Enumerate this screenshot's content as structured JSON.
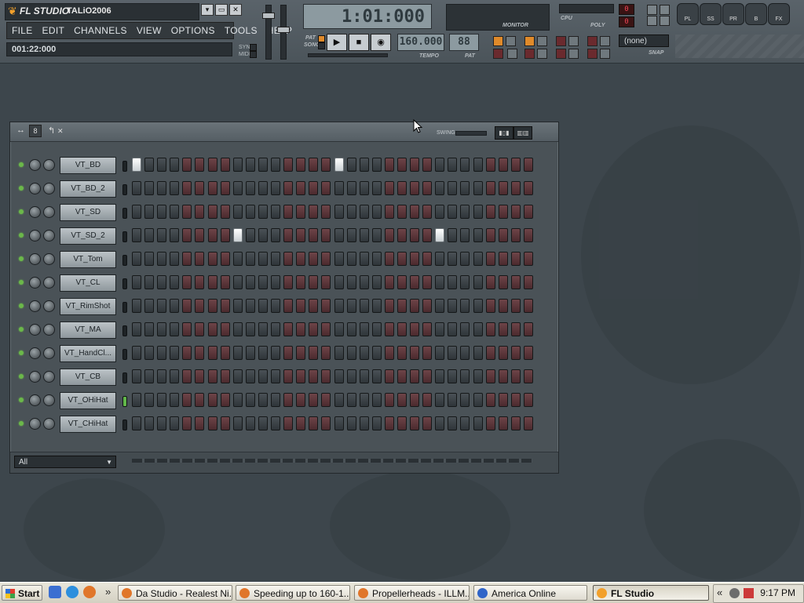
{
  "app": {
    "brand": "FL STUDIO",
    "project_name": "TALiO2006",
    "window_buttons": [
      "▾",
      "▭",
      "✕"
    ]
  },
  "menu": [
    "FILE",
    "EDIT",
    "CHANNELS",
    "VIEW",
    "OPTIONS",
    "TOOLS",
    "HELP"
  ],
  "position_readout": "001:22:000",
  "sync_labels": [
    "SYN",
    "MIDI"
  ],
  "song_position": "1:01:000",
  "transport": {
    "mode_labels": [
      "PAT",
      "SONG"
    ],
    "play_icon": "play-icon",
    "stop_icon": "stop-icon",
    "record_icon": "record-icon",
    "tempo_value": "160.000",
    "tempo_label": "TEMPO",
    "pattern_value": "88",
    "pattern_label": "PAT"
  },
  "meters": {
    "monitor_label": "MONITOR",
    "cpu_label": "CPU",
    "cpu_value": "0",
    "poly_label": "POLY",
    "poly_value": "0"
  },
  "snap": {
    "value": "(none)",
    "label": "SNAP"
  },
  "windows": {
    "playlist": "PL",
    "step_sequencer": "SS",
    "piano_roll": "PR",
    "browser": "B",
    "mixer": "FX"
  },
  "rack": {
    "swing_label": "SWING",
    "filter_value": "All",
    "channels": [
      {
        "name": "VT_BD",
        "active_steps": [
          1,
          17
        ],
        "selected": false
      },
      {
        "name": "VT_BD_2",
        "active_steps": [],
        "selected": false
      },
      {
        "name": "VT_SD",
        "active_steps": [],
        "selected": false
      },
      {
        "name": "VT_SD_2",
        "active_steps": [
          9,
          25
        ],
        "selected": false
      },
      {
        "name": "VT_Tom",
        "active_steps": [],
        "selected": false
      },
      {
        "name": "VT_CL",
        "active_steps": [],
        "selected": false
      },
      {
        "name": "VT_RimShot",
        "active_steps": [],
        "selected": false
      },
      {
        "name": "VT_MA",
        "active_steps": [],
        "selected": false
      },
      {
        "name": "VT_HandCl...",
        "active_steps": [],
        "selected": false
      },
      {
        "name": "VT_CB",
        "active_steps": [],
        "selected": false
      },
      {
        "name": "VT_OHiHat",
        "active_steps": [],
        "selected": true
      },
      {
        "name": "VT_CHiHat",
        "active_steps": [],
        "selected": false
      }
    ]
  },
  "taskbar": {
    "start_label": "Start",
    "tasks": [
      {
        "label": "Da Studio - Realest Ni...",
        "color": "#e0762a",
        "active": false
      },
      {
        "label": "Speeding up to 160-1...",
        "color": "#e0762a",
        "active": false
      },
      {
        "label": "Propellerheads - ILLM...",
        "color": "#e0762a",
        "active": false
      },
      {
        "label": "America  Online",
        "color": "#2f64c8",
        "active": false
      },
      {
        "label": "FL Studio",
        "color": "#f2a02b",
        "active": true
      }
    ],
    "clock": "9:17 PM"
  }
}
